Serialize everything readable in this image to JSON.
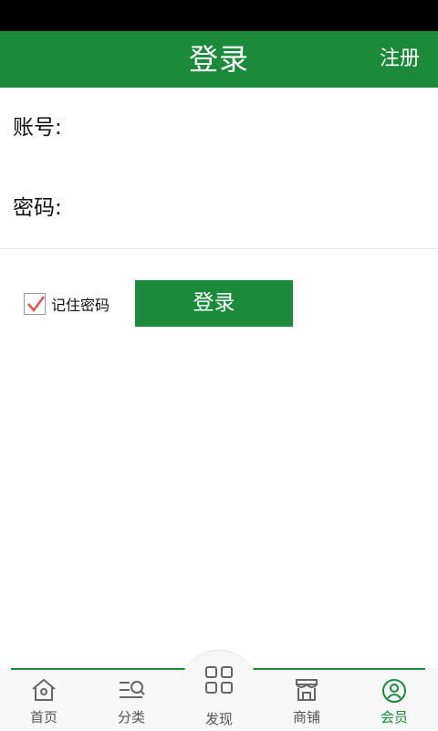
{
  "header": {
    "title": "登录",
    "register_label": "注册"
  },
  "form": {
    "account_label": "账号:",
    "account_value": "",
    "password_label": "密码:",
    "password_value": "",
    "remember_label": "记住密码",
    "remember_checked": true,
    "login_label": "登录"
  },
  "tabs": [
    {
      "label": "首页",
      "icon": "home-icon"
    },
    {
      "label": "分类",
      "icon": "category-icon"
    },
    {
      "label": "发现",
      "icon": "grid-icon"
    },
    {
      "label": "商铺",
      "icon": "shop-icon"
    },
    {
      "label": "会员",
      "icon": "user-icon",
      "active": true
    }
  ],
  "colors": {
    "brand": "#1b8a3a",
    "check": "#e05555"
  }
}
